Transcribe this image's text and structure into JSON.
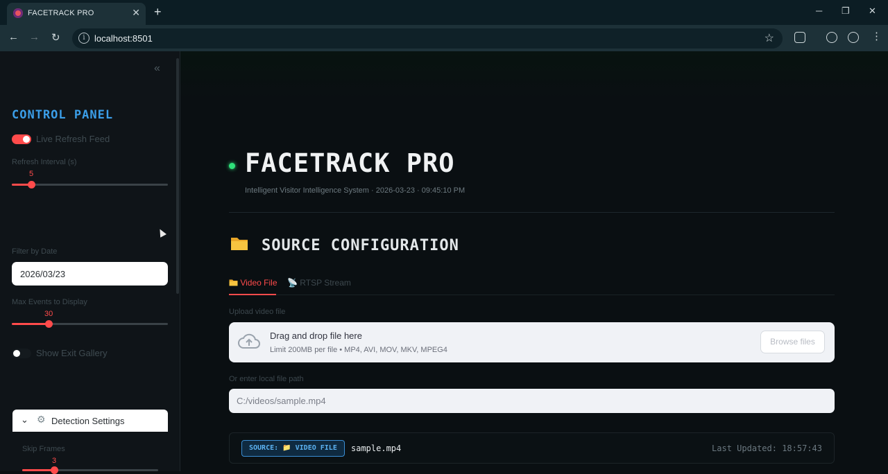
{
  "browser": {
    "tab_title": "FACETRACK PRO",
    "tab_close": "✕",
    "new_tab": "+",
    "url": "localhost:8501",
    "window_minimize": "─",
    "window_maximize": "❐",
    "window_close": "✕"
  },
  "sidebar": {
    "title": "CONTROL PANEL",
    "live_refresh_label": "Live Refresh Feed",
    "live_refresh_on": true,
    "refresh_interval_label": "Refresh Interval (s)",
    "refresh_interval_value": "5",
    "refresh_interval_fraction": 0.13,
    "filter_date_label": "Filter by Date",
    "filter_date_value": "2026/03/23",
    "max_events_label": "Max Events to Display",
    "max_events_value": "30",
    "max_events_fraction": 0.23,
    "exit_gallery_label": "Show Exit Gallery",
    "exit_gallery_on": false,
    "detection_settings_label": "Detection Settings",
    "skip_frames_label": "Skip Frames",
    "skip_frames_value": "3",
    "skip_frames_fraction": 0.22
  },
  "main": {
    "title": "FACETRACK PRO",
    "subtitle": "Intelligent Visitor Intelligence System · 2026-03-23 · 09:45:10 PM",
    "section_title": "SOURCE CONFIGURATION",
    "tabs": [
      {
        "label": "Video File",
        "active": true
      },
      {
        "label": "RTSP Stream",
        "active": false
      }
    ],
    "upload_label": "Upload video file",
    "dropzone_title": "Drag and drop file here",
    "dropzone_sub": "Limit 200MB per file • MP4, AVI, MOV, MKV, MPEG4",
    "browse_label": "Browse files",
    "path_label": "Or enter local file path",
    "path_value": "C:/videos/sample.mp4",
    "source_badge": "SOURCE: 📁 VIDEO FILE",
    "source_file": "sample.mp4",
    "last_updated": "Last Updated: 18:57:43"
  },
  "colors": {
    "accent": "#ff4b4b",
    "title_blue": "#3b9ee8",
    "live_green": "#2fe07a"
  }
}
